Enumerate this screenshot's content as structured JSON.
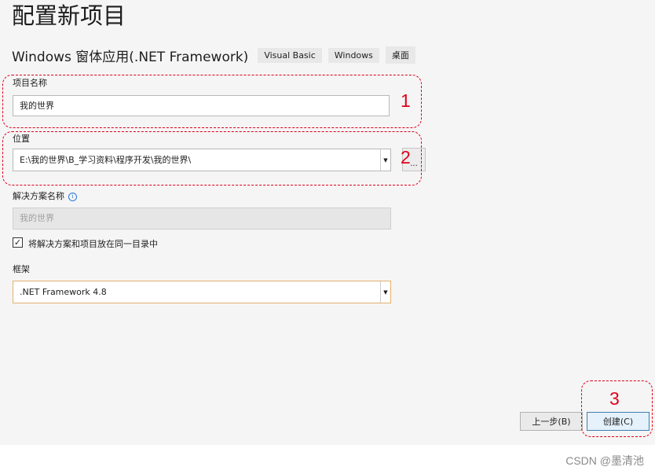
{
  "page": {
    "title": "配置新项目",
    "template_name": "Windows 窗体应用(.NET Framework)",
    "tags": [
      "Visual Basic",
      "Windows",
      "桌面"
    ]
  },
  "project_name": {
    "label": "项目名称",
    "value": "我的世界"
  },
  "location": {
    "label": "位置",
    "value": "E:\\我的世界\\B_学习资料\\程序开发\\我的世界\\",
    "browse_label": "..."
  },
  "solution": {
    "label": "解决方案名称",
    "info_icon": "i",
    "value": "我的世界",
    "checkbox_checked": true,
    "checkbox_label": "将解决方案和项目放在同一目录中"
  },
  "framework": {
    "label": "框架",
    "value": ".NET Framework 4.8"
  },
  "buttons": {
    "back": "上一步(B)",
    "create": "创建(C)"
  },
  "annotations": [
    "1",
    "2",
    "3"
  ],
  "annotation_color": "#e0001a",
  "watermark": "CSDN @墨清池"
}
